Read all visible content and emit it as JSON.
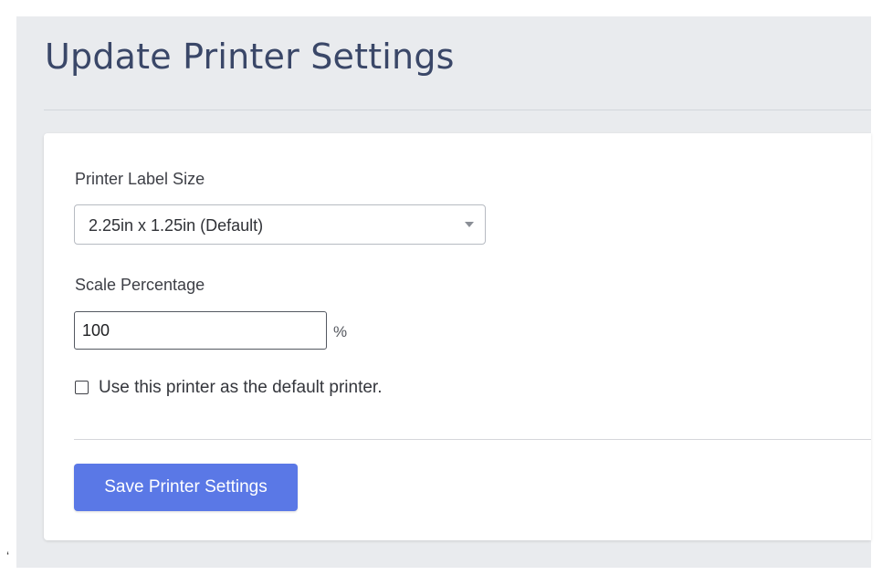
{
  "page": {
    "title": "Update Printer Settings"
  },
  "form": {
    "label_size": {
      "label": "Printer Label Size",
      "selected": "2.25in x 1.25in (Default)"
    },
    "scale": {
      "label": "Scale Percentage",
      "value": "100",
      "unit": "%"
    },
    "default_printer": {
      "label": "Use this printer as the default printer.",
      "checked": false
    },
    "save_label": "Save Printer Settings"
  },
  "stray_mark": "‘",
  "colors": {
    "page_background": "#e9ebee",
    "title": "#3a4768",
    "button": "#5a78e6"
  },
  "icons": {
    "select_caret": "caret-down-icon"
  }
}
